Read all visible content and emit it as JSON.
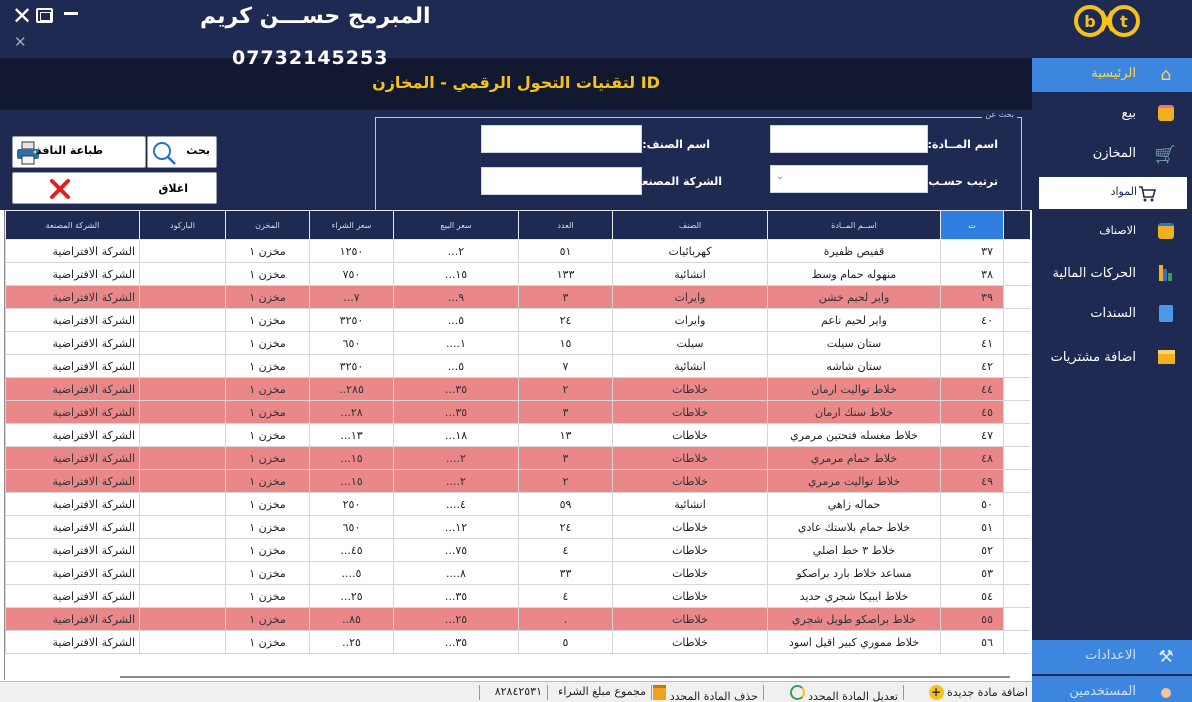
{
  "header": {
    "programmer_name": "المبرمج حســـن كريم",
    "phone": "07732145253",
    "page_title": "ID لتقنيات التحول الرقمي  - المخازن"
  },
  "search": {
    "legend": "بحث عن",
    "item_name_label": "اسم المــادة:",
    "type_name_label": "اسم الصنف:",
    "sort_label": "ترتيب حسـب:",
    "manufacturer_label": "الشركة المصنعة:",
    "item_name_value": "",
    "type_name_value": "",
    "sort_value": "",
    "manufacturer_value": ""
  },
  "actions": {
    "search": "بحث",
    "print": "طباعة النافذ",
    "close": "اغلاق"
  },
  "table": {
    "columns": [
      "ت",
      "اســم المــادة",
      "الصنف",
      "العدد",
      "سعر البيع",
      "سعر الشراء",
      "المخزن",
      "الباركود",
      "الشركة المصنعة"
    ],
    "rows": [
      {
        "n": "٣٧",
        "name": "قفيص ظفيرة",
        "type": "كهربائيات",
        "qty": "٥١",
        "sell": "٢...",
        "buy": "١٢٥٠",
        "store": "مخزن ١",
        "barcode": "",
        "company": "الشركة الافتراضية",
        "red": false
      },
      {
        "n": "٣٨",
        "name": "منهوله حمام وسط",
        "type": "انشائية",
        "qty": "١٣٣",
        "sell": "١٥...",
        "buy": "٧٥٠",
        "store": "مخزن ١",
        "barcode": "",
        "company": "الشركة الافتراضية",
        "red": false
      },
      {
        "n": "٣٩",
        "name": "واير لحيم خشن",
        "type": "وايرات",
        "qty": "٣",
        "sell": "٩...",
        "buy": "٧...",
        "store": "مخزن ١",
        "barcode": "",
        "company": "الشركة الافتراضية",
        "red": true
      },
      {
        "n": "٤٠",
        "name": "واير لحيم ناعم",
        "type": "وايرات",
        "qty": "٢٤",
        "sell": "٥...",
        "buy": "٣٢٥٠",
        "store": "مخزن ١",
        "barcode": "",
        "company": "الشركة الافتراضية",
        "red": false
      },
      {
        "n": "٤١",
        "name": "ستان سيلت",
        "type": "سيلت",
        "qty": "١٥",
        "sell": "١....",
        "buy": "٦٥٠",
        "store": "مخزن ١",
        "barcode": "",
        "company": "الشركة الافتراضية",
        "red": false
      },
      {
        "n": "٤٢",
        "name": "ستان شاشه",
        "type": "انشائية",
        "qty": "٧",
        "sell": "٥...",
        "buy": "٣٢٥٠",
        "store": "مخزن ١",
        "barcode": "",
        "company": "الشركة الافتراضية",
        "red": false
      },
      {
        "n": "٤٤",
        "name": "خلاط تواليت ارمان",
        "type": "خلاطات",
        "qty": "٢",
        "sell": "٣٥...",
        "buy": "٢٨٥..",
        "store": "مخزن ١",
        "barcode": "",
        "company": "الشركة الافتراضية",
        "red": true
      },
      {
        "n": "٤٥",
        "name": "خلاط سنك ارمان",
        "type": "خلاطات",
        "qty": "٣",
        "sell": "٣٥...",
        "buy": "٢٨...",
        "store": "مخزن ١",
        "barcode": "",
        "company": "الشركة الافتراضية",
        "red": true
      },
      {
        "n": "٤٧",
        "name": "خلاط مغسله فتحتين مرمري",
        "type": "خلاطات",
        "qty": "١٣",
        "sell": "١٨...",
        "buy": "١٣...",
        "store": "مخزن ١",
        "barcode": "",
        "company": "الشركة الافتراضية",
        "red": false
      },
      {
        "n": "٤٨",
        "name": "خلاط حمام مرمري",
        "type": "خلاطات",
        "qty": "٣",
        "sell": "٢....",
        "buy": "١٥...",
        "store": "مخزن ١",
        "barcode": "",
        "company": "الشركة الافتراضية",
        "red": true
      },
      {
        "n": "٤٩",
        "name": "خلاط تواليت مرمري",
        "type": "خلاطات",
        "qty": "٢",
        "sell": "٢....",
        "buy": "١٥...",
        "store": "مخزن ١",
        "barcode": "",
        "company": "الشركة الافتراضية",
        "red": true
      },
      {
        "n": "٥٠",
        "name": "حماله زاهي",
        "type": "انشائية",
        "qty": "٥٩",
        "sell": "٤....",
        "buy": "٢٥٠",
        "store": "مخزن ١",
        "barcode": "",
        "company": "الشركة الافتراضية",
        "red": false
      },
      {
        "n": "٥١",
        "name": "خلاط حمام بلاستك عادي",
        "type": "خلاطات",
        "qty": "٢٤",
        "sell": "١٢...",
        "buy": "٦٥٠",
        "store": "مخزن ١",
        "barcode": "",
        "company": "الشركة الافتراضية",
        "red": false
      },
      {
        "n": "٥٢",
        "name": "خلاط ٣ خط اصلي",
        "type": "خلاطات",
        "qty": "٤",
        "sell": "٧٥...",
        "buy": "٤٥...",
        "store": "مخزن ١",
        "barcode": "",
        "company": "الشركة الافتراضية",
        "red": false
      },
      {
        "n": "٥٣",
        "name": "مساعد خلاط بارد براصكو",
        "type": "خلاطات",
        "qty": "٣٣",
        "sell": "٨....",
        "buy": "٥....",
        "store": "مخزن ١",
        "barcode": "",
        "company": "الشركة الافتراضية",
        "red": false
      },
      {
        "n": "٥٤",
        "name": "خلاط ايبيكا شجري حديد",
        "type": "خلاطات",
        "qty": "٤",
        "sell": "٣٥...",
        "buy": "٢٥...",
        "store": "مخزن ١",
        "barcode": "",
        "company": "الشركة الافتراضية",
        "red": false
      },
      {
        "n": "٥٥",
        "name": "خلاط براصكو طويل شجري",
        "type": "خلاطات",
        "qty": ".",
        "sell": "٢٥...",
        "buy": "٨٥..",
        "store": "مخزن ١",
        "barcode": "",
        "company": "الشركة الافتراضية",
        "red": true
      },
      {
        "n": "٥٦",
        "name": "خلاط مموري كبير اقيل اسود",
        "type": "خلاطات",
        "qty": "٥",
        "sell": "٣٥...",
        "buy": "٢٥..",
        "store": "مخزن ١",
        "barcode": "",
        "company": "الشركة الافتراضية",
        "red": false
      }
    ]
  },
  "status": {
    "add_item": "اضافة مادة جديدة",
    "edit_item": "تعديل المادة المحدد",
    "delete_item": "حذف المادة المحدد",
    "purchase_total_label": "مجموع مبلغ الشراء",
    "purchase_total_value": "٨٢٨٤٢٥٣١"
  },
  "sidebar": {
    "home": "الرئيسية",
    "sell": "بيع",
    "stores": "المخازن",
    "materials": "المواد",
    "categories": "الاصناف",
    "finance": "الحركات المالية",
    "vouchers": "السندات",
    "add_purchases": "اضافة مشتريات",
    "settings": "الاعدادات",
    "users": "المستخدمين"
  },
  "colors": {
    "navy": "#1f2a52",
    "accent_blue": "#3d86e0",
    "title_yellow": "#f5c218",
    "low_stock_red": "#e98789"
  }
}
